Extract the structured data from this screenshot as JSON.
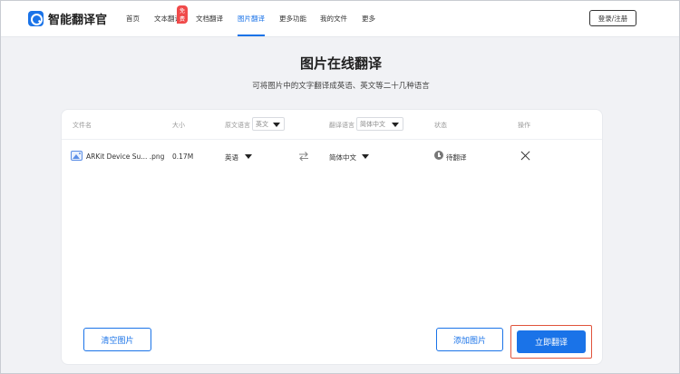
{
  "header": {
    "logo_text": "智能翻译官",
    "nav": [
      {
        "label": "首页"
      },
      {
        "label": "文本翻译",
        "badge": "免费"
      },
      {
        "label": "文档翻译"
      },
      {
        "label": "图片翻译",
        "active": true
      },
      {
        "label": "更多功能"
      },
      {
        "label": "我的文件"
      },
      {
        "label": "更多"
      }
    ],
    "login_label": "登录/注册"
  },
  "page": {
    "title": "图片在线翻译",
    "subtitle": "可将图片中的文字翻译成英语、英文等二十几种语言"
  },
  "table": {
    "headers": {
      "filename": "文件名",
      "size": "大小",
      "source_lang": "原文语言",
      "target_lang": "翻译语言",
      "status": "状态",
      "action": "操作"
    },
    "header_source_select": "英文",
    "header_target_select": "简体中文",
    "rows": [
      {
        "filename": "ARKit Device Su... .png",
        "size": "0.17M",
        "source_lang": "英语",
        "target_lang": "简体中文",
        "status": "待翻译"
      }
    ]
  },
  "buttons": {
    "clear": "清空图片",
    "add": "添加图片",
    "translate": "立即翻译"
  },
  "colors": {
    "accent": "#1a73e8",
    "highlight_border": "#e0533b",
    "badge": "#f04a4a"
  }
}
